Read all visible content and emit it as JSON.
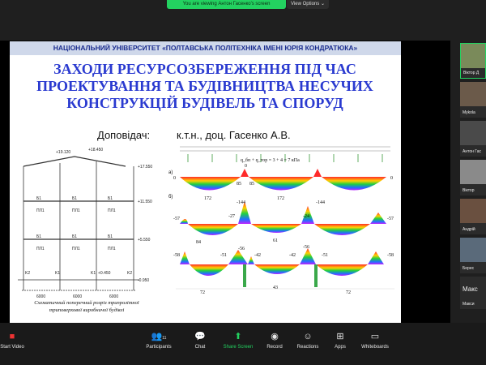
{
  "share_banner": {
    "text": "You are viewing Антон Гасенко's screen",
    "view_options": "View Options ⌄"
  },
  "slide": {
    "university": "НАЦІОНАЛЬНИЙ УНІВЕРСИТЕТ «ПОЛТАВСЬКА ПОЛІТЕХНІКА ІМЕНІ ЮРІЯ КОНДРАТЮКА»",
    "title_lines": [
      "ЗАХОДИ РЕСУРСОЗБЕРЕЖЕННЯ ПІД ЧАС",
      "ПРОЕКТУВАННЯ ТА БУДІВНИЦТВА НЕСУЧИХ",
      "КОНСТРУКЦІЙ БУДІВЕЛЬ ТА СПОРУД"
    ],
    "speaker_label": "Доповідач:",
    "speaker_name": "к.т.н., доц. Гасенко А.В.",
    "caption_line1": "Схематичний поперечний розріз трипролітної",
    "caption_line2": "триповерхової виробничої будівлі",
    "frame": {
      "top_left": "+19.120",
      "top_mid": "+18.450",
      "levels": [
        "+17.550",
        "+11.550",
        "+5.550",
        "+0.450",
        "-0.950"
      ],
      "beam_labels": [
        "Б1",
        "Б1",
        "Б1"
      ],
      "slab_labels": [
        "ПЛ1",
        "ПЛ1",
        "ПЛ1"
      ],
      "col_labels": [
        "K2",
        "K1",
        "K1",
        "K2"
      ],
      "spans": [
        "6000",
        "6000",
        "6000"
      ],
      "axes": [
        "А",
        "Б",
        "В",
        "Г"
      ]
    },
    "beams": {
      "load_formula": "q_бп + q_тор = 3 + 4 = 7 кПа",
      "row_a_letter": "а)",
      "row_b_letter": "б)",
      "row1": [
        "0",
        "172",
        "85",
        "0",
        "85",
        "172",
        "0"
      ],
      "row2": [
        "-57",
        "-144",
        "-27",
        "-24",
        "-144",
        "-57",
        "84",
        "61"
      ],
      "row3": [
        "-58",
        "-51",
        "-56",
        "-42",
        "-42",
        "-56",
        "-51",
        "-58",
        "72",
        "43",
        "72"
      ]
    }
  },
  "participants": [
    {
      "name": "Віктор Д",
      "color": "#7a8a5a"
    },
    {
      "name": "Mykola",
      "color": "#6b5a4a"
    },
    {
      "name": "Антон Гас",
      "color": "#4a4a4a"
    },
    {
      "name": "Віктор",
      "color": "#8a8a8a"
    },
    {
      "name": "Андрій",
      "color": "#6a5040"
    },
    {
      "name": "Берес",
      "color": "#5a6a7a"
    },
    {
      "name": "Макс",
      "color": "#2b2b2b"
    },
    {
      "name": "Макси",
      "color": "#2b2b2b"
    }
  ],
  "toolbar": {
    "video": "Start Video",
    "participants": "Participants",
    "participants_count": "11",
    "chat": "Chat",
    "share": "Share Screen",
    "record": "Record",
    "reactions": "Reactions",
    "apps": "Apps",
    "whiteboards": "Whiteboards"
  }
}
